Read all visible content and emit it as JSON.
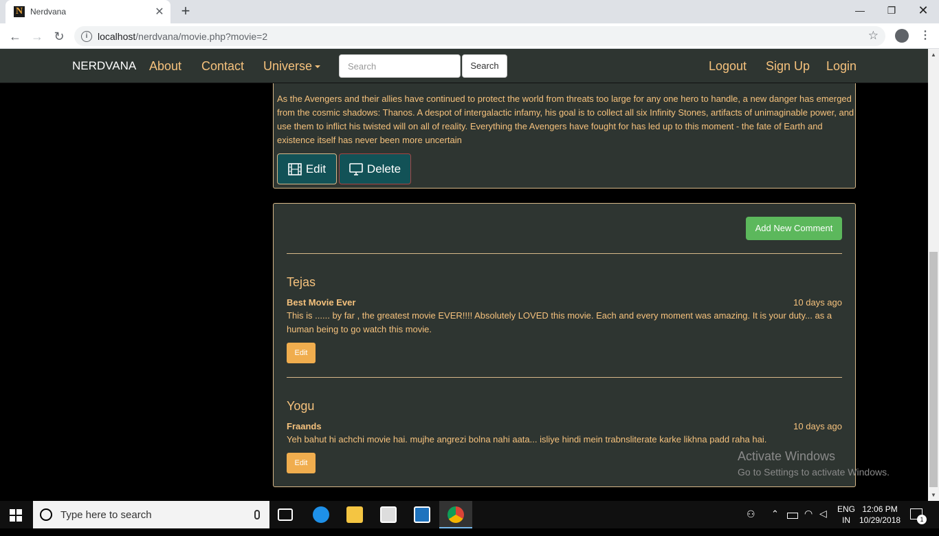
{
  "browser": {
    "tab_title": "Nerdvana",
    "favicon_letter": "N",
    "url_host": "localhost",
    "url_path": "/nerdvana/movie.php?movie=2"
  },
  "navbar": {
    "brand": "NERDVANA",
    "links": [
      "About",
      "Contact",
      "Universe"
    ],
    "search_placeholder": "Search",
    "search_button": "Search",
    "right_links": [
      "Logout",
      "Sign Up",
      "Login"
    ]
  },
  "movie": {
    "synopsis": "As the Avengers and their allies have continued to protect the world from threats too large for any one hero to handle, a new danger has emerged from the cosmic shadows: Thanos. A despot of intergalactic infamy, his goal is to collect all six Infinity Stones, artifacts of unimaginable power, and use them to inflict his twisted will on all of reality. Everything the Avengers have fought for has led up to this moment - the fate of Earth and existence itself has never been more uncertain",
    "edit_label": "Edit",
    "delete_label": "Delete"
  },
  "comments": {
    "add_label": "Add New Comment",
    "items": [
      {
        "author": "Tejas",
        "title": "Best Movie Ever",
        "time": "10 days ago",
        "body": "This is ...... by far , the greatest movie EVER!!!! Absolutely LOVED this movie. Each and every moment was amazing. It is your duty... as a human being to go watch this movie.",
        "edit_label": "Edit"
      },
      {
        "author": "Yogu",
        "title": "Fraands",
        "time": "10 days ago",
        "body": "Yeh bahut hi achchi movie hai. mujhe angrezi bolna nahi aata... isliye hindi mein trabnsliterate karke likhna padd raha hai.",
        "edit_label": "Edit"
      }
    ]
  },
  "watermark": {
    "title": "Activate Windows",
    "subtitle": "Go to Settings to activate Windows."
  },
  "taskbar": {
    "search_placeholder": "Type here to search",
    "lang_top": "ENG",
    "lang_bottom": "IN",
    "time": "12:06 PM",
    "date": "10/29/2018",
    "notif_count": "1"
  }
}
